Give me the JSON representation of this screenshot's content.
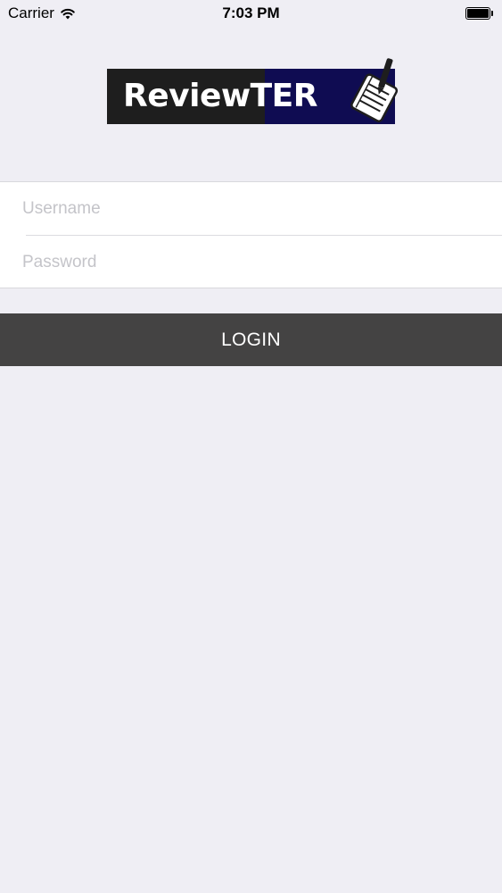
{
  "status_bar": {
    "carrier": "Carrier",
    "time": "7:03 PM",
    "signal_icon": "wifi-icon",
    "battery_icon": "battery-icon"
  },
  "logo": {
    "text": "ReviewTER",
    "icon": "notepad-pen-icon",
    "colors": {
      "left_bg": "#1e1e1e",
      "right_bg": "#0f0c52",
      "text": "#ffffff"
    }
  },
  "form": {
    "username_placeholder": "Username",
    "password_placeholder": "Password",
    "username_value": "",
    "password_value": ""
  },
  "login_button": {
    "label": "LOGIN",
    "bg_color": "#444343"
  }
}
